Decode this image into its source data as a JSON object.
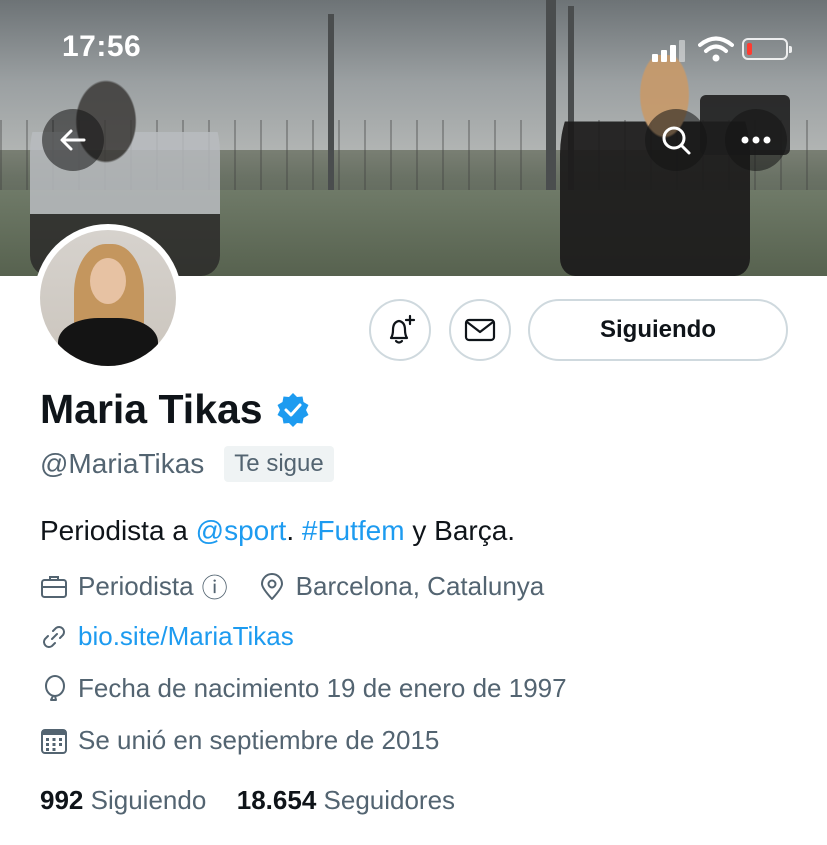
{
  "status_bar": {
    "time": "17:56"
  },
  "header": {
    "back_icon": "arrow-left-icon",
    "search_icon": "search-icon",
    "more_icon": "more-horizontal-icon"
  },
  "actions": {
    "notify_icon": "bell-plus-icon",
    "message_icon": "envelope-icon",
    "following_label": "Siguiendo"
  },
  "profile": {
    "name": "Maria Tikas",
    "handle": "@MariaTikas",
    "follows_you": "Te sigue",
    "bio": {
      "prefix": "Periodista a ",
      "mention": "@sport",
      "mid": ". ",
      "hashtag": "#Futfem",
      "suffix": " y Barça."
    },
    "profession": "Periodista",
    "profession_info_icon": "ⓘ",
    "location": "Barcelona, Catalunya",
    "website": "bio.site/MariaTikas",
    "birthdate": "Fecha de nacimiento 19 de enero de 1997",
    "joined": "Se unió en septiembre de 2015",
    "following_count": "992",
    "following_label": "Siguiendo",
    "followers_count": "18.654",
    "followers_label": "Seguidores"
  },
  "colors": {
    "accent": "#1d9bf0",
    "text": "#0f1419",
    "muted": "#536471",
    "border": "#cfd9de",
    "battery_low": "#ff3b30"
  }
}
